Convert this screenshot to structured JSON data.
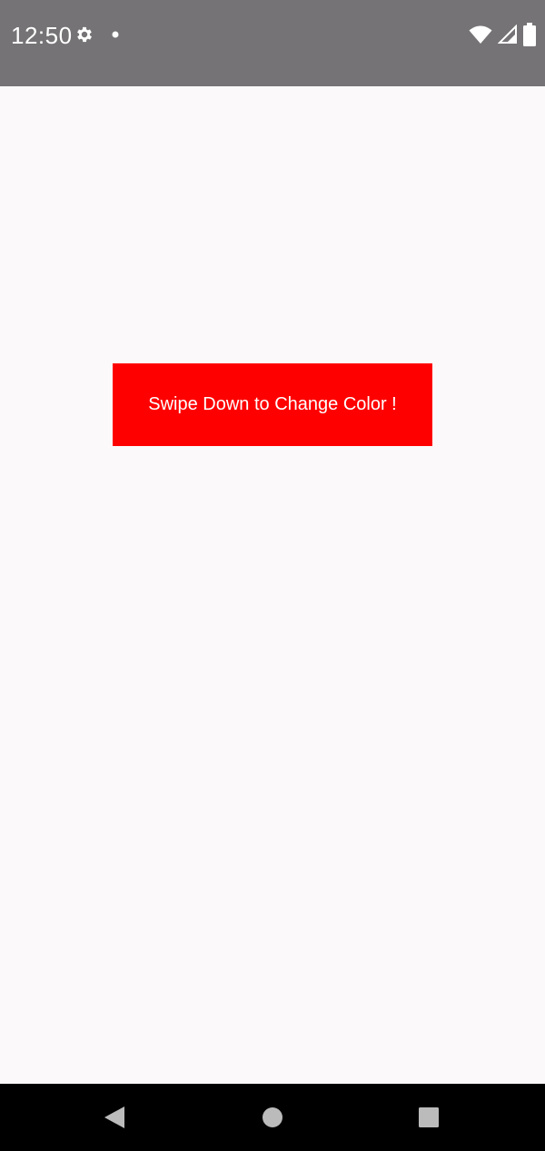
{
  "status_bar": {
    "time": "12:50",
    "background": "#757375",
    "icons_left": [
      "gear-icon",
      "notification-dot-icon"
    ],
    "icons_right": [
      "wifi-icon",
      "cell-signal-icon",
      "battery-icon"
    ]
  },
  "main": {
    "background": "#fcf9fa",
    "swipe_button": {
      "label": "Swipe Down to Change Color !",
      "background": "#ff0000",
      "text_color": "#ffffff"
    }
  },
  "nav_bar": {
    "background": "#000000",
    "buttons": [
      "back-icon",
      "home-icon",
      "recents-icon"
    ],
    "icon_color": "#bbbbbb"
  }
}
